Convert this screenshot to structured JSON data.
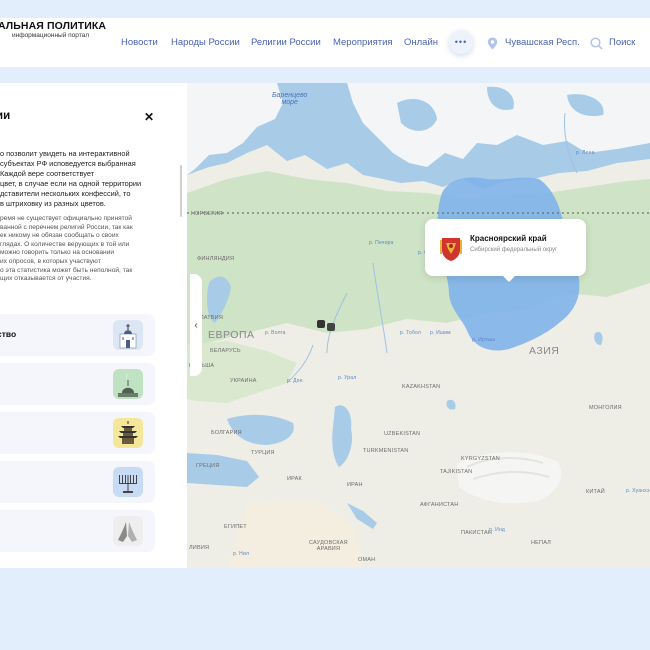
{
  "header": {
    "logo_title": "АЛЬНАЯ ПОЛИТИКА",
    "logo_subtitle": "информационный портал",
    "nav": [
      "Новости",
      "Народы России",
      "Религии России",
      "Мероприятия",
      "Онлайн"
    ],
    "more": "•••",
    "location": "Чувашская Респ.",
    "search": "Поиск"
  },
  "panel": {
    "title": "ии",
    "close": "✕",
    "description_lines": [
      "о позволит увидеть на интерактивной",
      "субъектах РФ исповедуется выбранная",
      "Каждой вере соответствует",
      "цвет, в случае если на одной территории",
      "дставители нескольких конфессий, то",
      "в штриховку из разных цветов."
    ],
    "note_lines": [
      "ремя не существует официально принятой",
      "ванной с перечнем религий России, так как",
      "ек никому не обязан сообщать о своих",
      "глядах. О количестве верующих в той или",
      "можно говорить только на основании",
      "их опросов, в которых участвуют",
      "о эта статистика может быть неполной, так",
      "щих отказывается от участия."
    ],
    "cards": [
      {
        "label": "ство",
        "icon": "orthodox-church-icon"
      },
      {
        "label": "",
        "icon": "mosque-icon"
      },
      {
        "label": "",
        "icon": "pagoda-icon"
      },
      {
        "label": "",
        "icon": "menorah-icon"
      },
      {
        "label": "",
        "icon": "praying-hands-icon"
      }
    ],
    "collapse": "‹"
  },
  "tooltip": {
    "title": "Красноярский край",
    "subtitle": "Сибирский федеральный округ",
    "icon": "coat-of-arms-icon"
  },
  "map": {
    "labels": {
      "barents": [
        "Баренцево",
        "море"
      ],
      "europe": "ЕВРОПА",
      "asia": "АЗИЯ",
      "finland": "ФИНЛЯНДИЯ",
      "belarus": "БЕЛАРУСЬ",
      "ukraine": "УКРАИНА",
      "poland": "ПОЛЬША",
      "latvia": "ЛАТВИЯ",
      "kazakhstan": "KAZAKHSTAN",
      "turkmenistan": "TURKMENISTAN",
      "uzbekistan": "UZBEKISTAN",
      "mongolia": "МОНГОЛИЯ",
      "turkey": "ТУРЦИЯ",
      "iran": "ИРАН",
      "iraq": "ИРАК",
      "egypt": "ЕГИПЕТ",
      "saudi": [
        "САУДОВСКАЯ",
        "АРАВИЯ"
      ],
      "afghanistan": "АФГАНИСТАН",
      "pakistan": "ПАКИСТАН",
      "china": "КИТАЙ",
      "bulgaria": "БОЛГАРИЯ",
      "greece": "ГРЕЦИЯ",
      "libya": "ЛИВИЯ",
      "oman": "ОМАН",
      "tajikistan": "TAJIKISTAN",
      "kyrgyzstan": "KYRGYZSTAN",
      "nepal": "НЕПАЛ",
      "norway": "НОРВЕГИЯ"
    },
    "rivers": {
      "don": "р. Дон",
      "ural": "р. Урал",
      "ob": "р. Обь",
      "pechora": "р. Печора",
      "volga": "р. Волга",
      "nil": "р. Нил",
      "ishim": "р. Ишим",
      "tobol": "р. Тобол",
      "irtysh": "р. Иртыш",
      "lena": "р. Лена",
      "ind": "р. Инд",
      "huanghe": "р. Хуанхэ"
    },
    "colors": {
      "highlight": "#7fb3ea",
      "land": "#eeeee6",
      "forest": "#cfe3c6",
      "water": "#a8cbe8"
    }
  }
}
